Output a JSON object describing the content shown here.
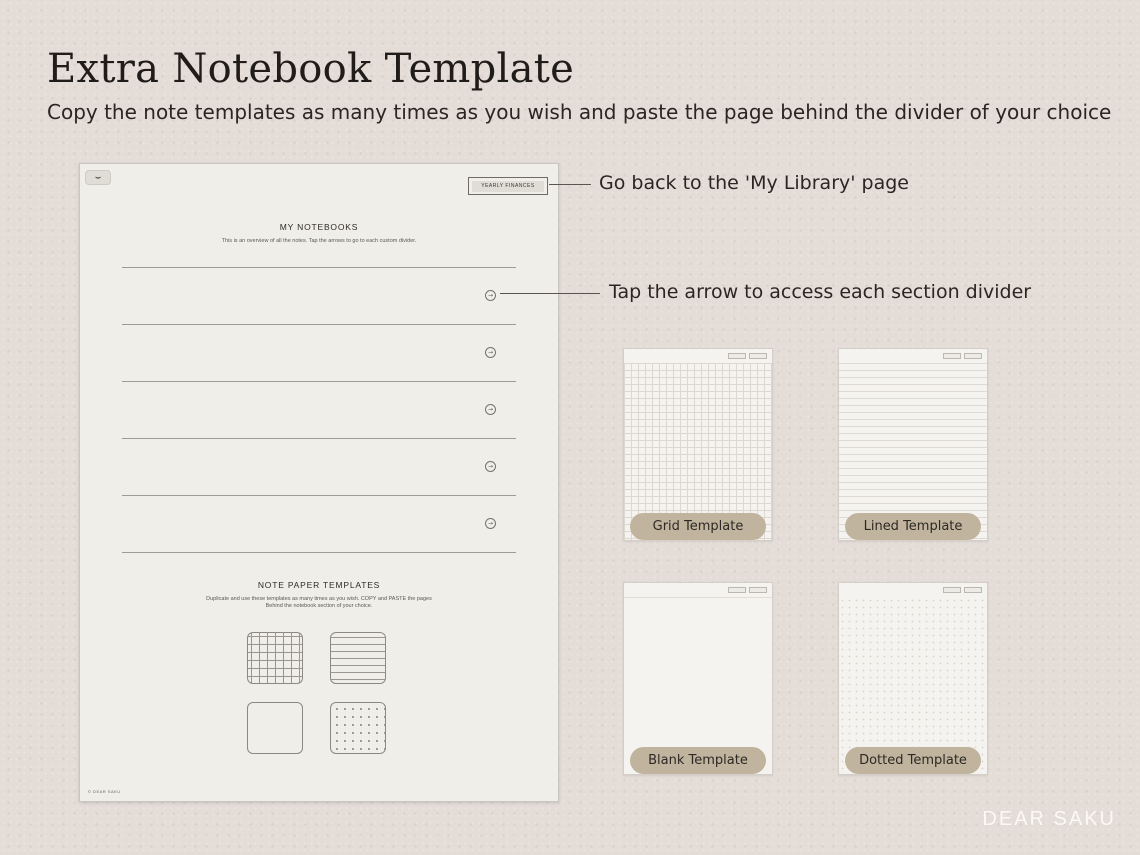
{
  "header": {
    "title": "Extra Notebook Template",
    "subtitle": "Copy the note templates as many times as you wish and paste the page behind the divider of your choice"
  },
  "notebook": {
    "back_tab": "⌣",
    "library_button": "YEARLY FINANCES",
    "heading": "MY NOTEBOOKS",
    "description": "This is an overview of all the notes. Tap the arrows to go to each custom divider.",
    "row_arrow": "→",
    "rows": 5,
    "templates_heading": "NOTE PAPER TEMPLATES",
    "templates_desc_line1": "Duplicate and use these templates as many times as you wish. COPY and PASTE the pages",
    "templates_desc_line2": "Behind the notebook section of your choice.",
    "brand": "© DEAR SAKU"
  },
  "callouts": {
    "library": "Go back to the 'My Library' page",
    "arrow": "Tap the arrow to access each section divider"
  },
  "templates": [
    {
      "label": "Grid Template"
    },
    {
      "label": "Lined Template"
    },
    {
      "label": "Blank Template"
    },
    {
      "label": "Dotted Template"
    }
  ],
  "brand_mark": "DEAR SAKU",
  "colors": {
    "background": "#e4dcd6",
    "paper": "#efeee8",
    "label_pill": "#c0b49e"
  }
}
